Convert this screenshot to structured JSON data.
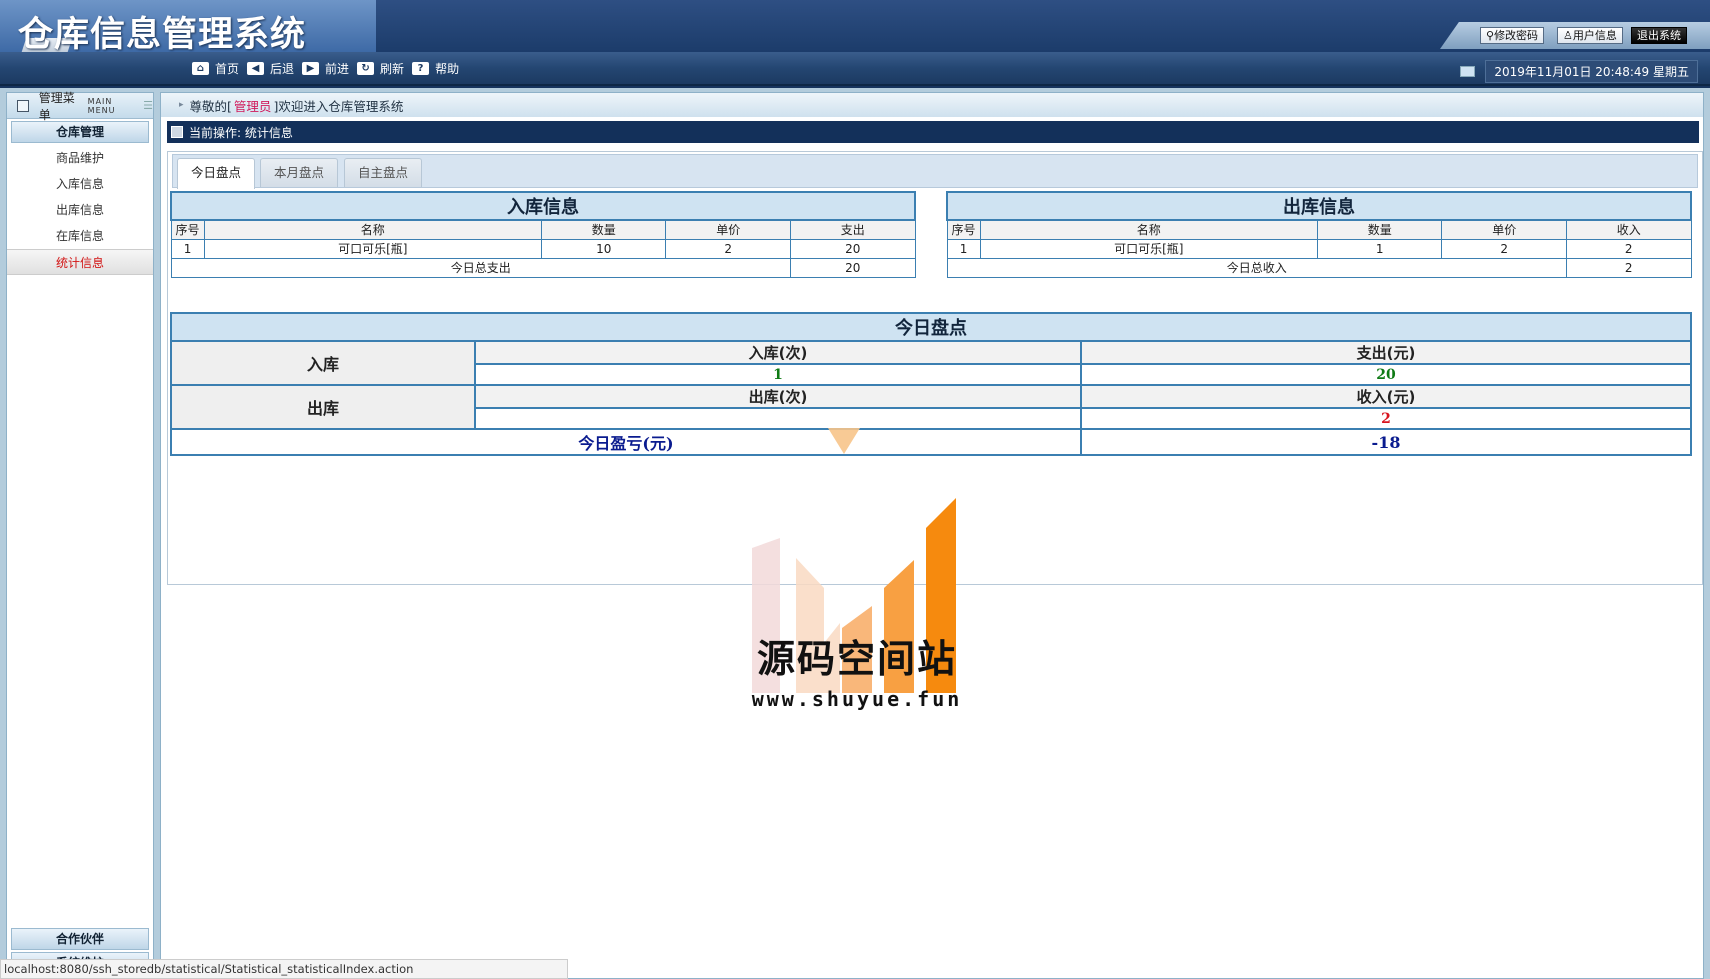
{
  "header": {
    "app_title": "仓库信息管理系统",
    "top_buttons": [
      "修改密码",
      "用户信息",
      "退出系统"
    ],
    "nav": [
      {
        "icon": "home-icon",
        "label": "首页"
      },
      {
        "icon": "back-icon",
        "label": "后退"
      },
      {
        "icon": "forward-icon",
        "label": "前进"
      },
      {
        "icon": "refresh-icon",
        "label": "刷新"
      },
      {
        "icon": "help-icon",
        "label": "帮助"
      }
    ],
    "datetime": "2019年11月01日 20:48:49 星期五"
  },
  "sidebar": {
    "title": "管理菜单",
    "title_en": "MAIN MENU",
    "group": "仓库管理",
    "items": [
      "商品维护",
      "入库信息",
      "出库信息",
      "在库信息",
      "统计信息"
    ],
    "active_item": "统计信息",
    "bottom_groups": [
      "合作伙伴",
      "系统维护"
    ]
  },
  "welcome": {
    "prefix": "尊敬的[",
    "role": "管理员",
    "suffix": "]欢迎进入仓库管理系统"
  },
  "current_op": "当前操作: 统计信息",
  "tabs": [
    "今日盘点",
    "本月盘点",
    "自主盘点"
  ],
  "active_tab": "今日盘点",
  "inbound": {
    "title": "入库信息",
    "headers": [
      "序号",
      "名称",
      "数量",
      "单价",
      "支出"
    ],
    "rows": [
      [
        "1",
        "可口可乐[瓶]",
        "10",
        "2",
        "20"
      ]
    ],
    "total_label": "今日总支出",
    "total_value": "20"
  },
  "outbound": {
    "title": "出库信息",
    "headers": [
      "序号",
      "名称",
      "数量",
      "单价",
      "收入"
    ],
    "rows": [
      [
        "1",
        "可口可乐[瓶]",
        "1",
        "2",
        "2"
      ]
    ],
    "total_label": "今日总收入",
    "total_value": "2"
  },
  "summary": {
    "title": "今日盘点",
    "in_label": "入库",
    "in_count_header": "入库(次)",
    "in_count": "1",
    "expense_header": "支出(元)",
    "expense": "20",
    "out_label": "出库",
    "out_count_header": "出库(次)",
    "out_count": "",
    "income_header": "收入(元)",
    "income": "2",
    "profit_label": "今日盈亏(元)",
    "profit": "-18"
  },
  "watermark": {
    "name": "源码空间站",
    "url": "www.shuyue.fun"
  },
  "status_url": "localhost:8080/ssh_storedb/statistical/Statistical_statisticalIndex.action",
  "colors": {
    "header_dark": "#17345d",
    "border_blue": "#3b7fb1",
    "active_red": "#d21414",
    "profit_navy": "#0a1b8f"
  }
}
